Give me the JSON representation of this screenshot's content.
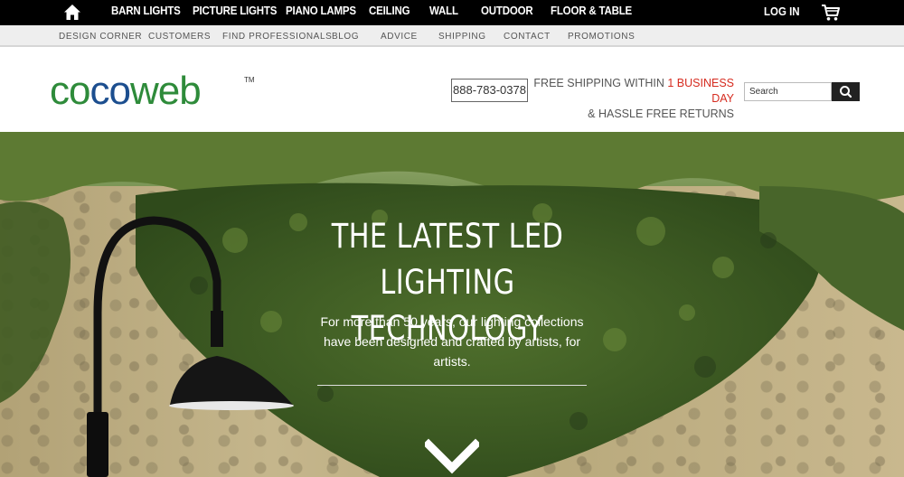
{
  "topnav": {
    "categories": [
      "BARN LIGHTS",
      "PICTURE LIGHTS",
      "PIANO LAMPS",
      "CEILING",
      "WALL",
      "OUTDOOR",
      "FLOOR & TABLE"
    ],
    "login": "LOG IN"
  },
  "subnav": {
    "items": [
      "DESIGN CORNER",
      "CUSTOMERS",
      "FIND PROFESSIONALS",
      "BLOG",
      "ADVICE",
      "SHIPPING",
      "CONTACT",
      "PROMOTIONS"
    ]
  },
  "header": {
    "logo_parts": [
      "co",
      "co",
      "web"
    ],
    "logo_tm": "TM",
    "phone": "888-783-0378",
    "shipping_line1_prefix": "FREE SHIPPING WITHIN ",
    "shipping_line1_highlight": "1 BUSINESS DAY",
    "shipping_line2": "& HASSLE FREE RETURNS",
    "search_placeholder": "Search"
  },
  "hero": {
    "title_line1": "THE LATEST LED LIGHTING",
    "title_line2": "TECHNOLOGY",
    "subtitle": "For more than 50 years, our lighting collections have been designed and crafted by artists, for artists."
  },
  "colors": {
    "topnav_bg": "#000000",
    "subnav_bg": "#eeeeee",
    "logo_green": "#2e8b3a",
    "logo_blue": "#1c4e8f",
    "highlight_red": "#d62b1f"
  }
}
